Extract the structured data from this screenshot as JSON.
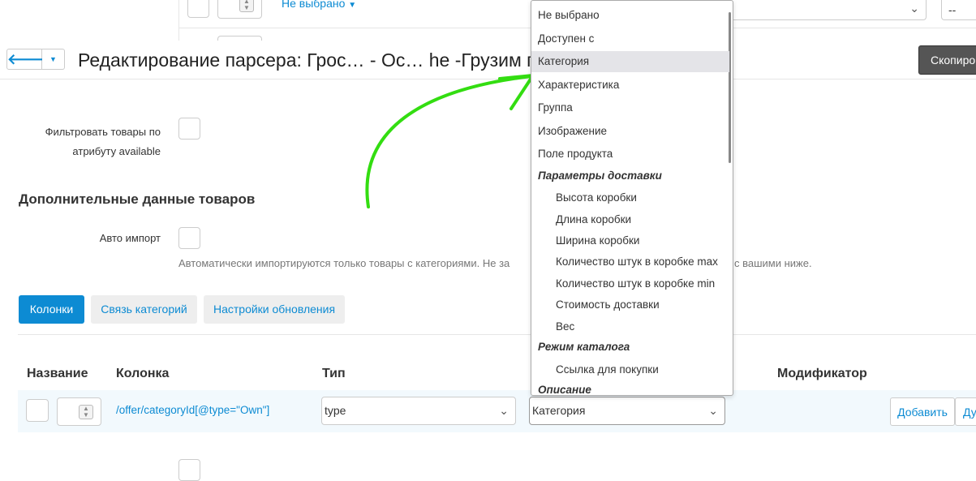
{
  "top_row": {
    "select_value": "Не выбрано",
    "right_value": "--"
  },
  "header": {
    "title": "Редактирование парсера: Грос…                 - Ос…                                        he -Грузим посл…",
    "copy_button": "Скопиро"
  },
  "settings": {
    "filter_label_line1": "Фильтровать товары по",
    "filter_label_line2": "атрибуту available",
    "section_title": "Дополнительные данные товаров",
    "auto_import_label": "Авто импорт",
    "auto_import_hint_left": "Автоматически импортируются только товары с категориями. Не за",
    "auto_import_hint_right": "с вашими ниже."
  },
  "tabs": [
    "Колонки",
    "Связь категорий",
    "Настройки обновления"
  ],
  "table": {
    "headers": {
      "name": "Название",
      "column": "Колонка",
      "type": "Тип",
      "modifier": "Модификатор"
    },
    "row": {
      "column": "/offer/categoryId[@type=\"Own\"]",
      "type_value": "type",
      "select_value": "Категория",
      "add_button": "Добавить",
      "dup_button": "Ду"
    }
  },
  "dropdown": {
    "options": [
      {
        "label": "Не выбрано",
        "kind": "opt"
      },
      {
        "label": "Доступен с",
        "kind": "opt"
      },
      {
        "label": "Категория",
        "kind": "opt",
        "selected": true
      },
      {
        "label": "Характеристика",
        "kind": "opt"
      },
      {
        "label": "Группа",
        "kind": "opt"
      },
      {
        "label": "Изображение",
        "kind": "opt"
      },
      {
        "label": "Поле продукта",
        "kind": "opt"
      },
      {
        "label": "Параметры доставки",
        "kind": "group"
      },
      {
        "label": "Высота коробки",
        "kind": "sub"
      },
      {
        "label": "Длина коробки",
        "kind": "sub"
      },
      {
        "label": "Ширина коробки",
        "kind": "sub"
      },
      {
        "label": "Количество штук в коробке max",
        "kind": "sub"
      },
      {
        "label": "Количество штук в коробке min",
        "kind": "sub"
      },
      {
        "label": "Стоимость доставки",
        "kind": "sub"
      },
      {
        "label": "Вес",
        "kind": "sub"
      },
      {
        "label": "Режим каталога",
        "kind": "group"
      },
      {
        "label": "Ссылка для покупки",
        "kind": "sub"
      },
      {
        "label": "Описание",
        "kind": "group"
      }
    ]
  },
  "colors": {
    "accent": "#0d8bd3",
    "annotation": "#33dd11",
    "selected_option": "#e4e4e8"
  }
}
